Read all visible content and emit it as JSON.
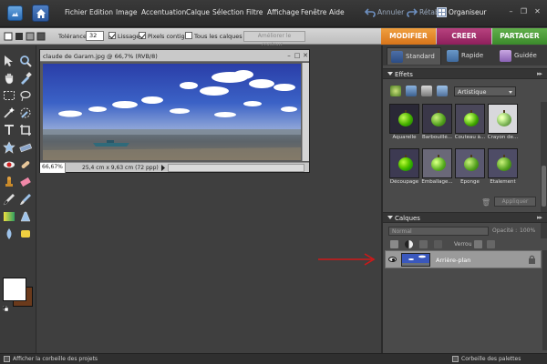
{
  "menubar": {
    "items": [
      "Fichier",
      "Edition",
      "Image",
      "Accentuation",
      "Calque",
      "Sélection",
      "Filtre",
      "Affichage",
      "Fenêtre",
      "Aide"
    ],
    "undo_label": "Annuler",
    "redo_label": "Rétablir",
    "organiser_label": "Organiseur"
  },
  "optionsbar": {
    "tolerance_label": "Tolérance :",
    "tolerance_value": "32",
    "lissage_label": "Lissage",
    "pixels_contigus_label": "Pixels contigus",
    "tous_calques_label": "Tous les calques",
    "ameliorer_label": "Améliorer le contour..."
  },
  "mode_tabs": {
    "modifier": "MODIFIER",
    "creer": "CREER",
    "partager": "PARTAGER"
  },
  "document": {
    "title": "claude de Garam.jpg @ 66,7% (RVB/8)",
    "zoom": "66,67%",
    "size_info": "25,4 cm x 9,63 cm (72 ppp)"
  },
  "panel_tabs": {
    "standard": "Standard",
    "rapide": "Rapide",
    "guidee": "Guidée"
  },
  "effects": {
    "header": "Effets",
    "category": "Artistique",
    "items": [
      "Aquarelle",
      "Barbouillé...",
      "Couteau à...",
      "Crayon de...",
      "Découpage",
      "Emballage...",
      "Eponge",
      "Etalement"
    ],
    "apply_label": "Appliquer"
  },
  "layers": {
    "header": "Calques",
    "blend_mode": "Normal",
    "opacity_label": "Opacité :",
    "opacity_value": "100%",
    "lock_label": "Verrou :",
    "layer_name": "Arrière-plan"
  },
  "bottombar": {
    "left_label": "Afficher la corbeille des projets",
    "right_label": "Corbeille des palettes"
  },
  "colors": {
    "modifier": "#e88620",
    "creer": "#a32a6f",
    "partager": "#4b9b3b",
    "annotation_arrow": "#d01818"
  }
}
